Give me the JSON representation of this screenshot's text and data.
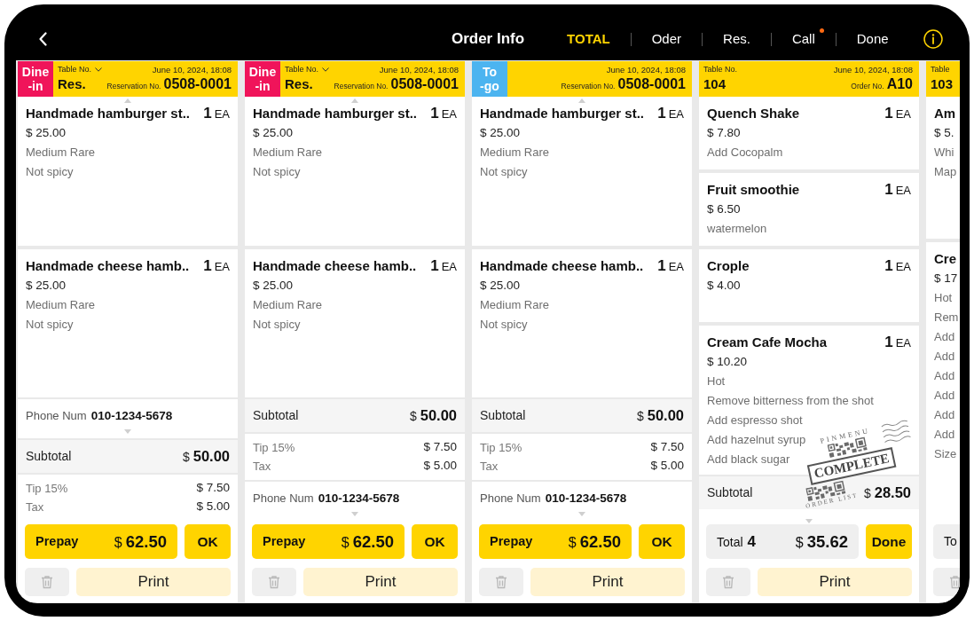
{
  "header": {
    "title": "Order Info",
    "tabs": [
      {
        "label": "TOTAL",
        "selected": true,
        "badge": false
      },
      {
        "label": "Oder",
        "selected": false,
        "badge": false
      },
      {
        "label": "Res.",
        "selected": false,
        "badge": false
      },
      {
        "label": "Call",
        "selected": false,
        "badge": true
      },
      {
        "label": "Done",
        "selected": false,
        "badge": false
      }
    ]
  },
  "orders": [
    {
      "type": {
        "kind": "dine_in",
        "label": "Dine\n-in"
      },
      "table": {
        "label": "Table No.",
        "dropdown": true,
        "value": "Res."
      },
      "date": "June 10, 2024, 18:08",
      "number": {
        "label": "Reservation No.",
        "value": "0508-0001"
      },
      "more_above": true,
      "items": [
        {
          "name": "Handmade hamburger st..",
          "qty": "1",
          "unit": "EA",
          "price": "$ 25.00",
          "options": [
            "Medium Rare",
            "Not spicy"
          ]
        },
        {
          "name": "Handmade cheese hamb..",
          "qty": "1",
          "unit": "EA",
          "price": "$ 25.00",
          "options": [
            "Medium Rare",
            "Not spicy"
          ]
        }
      ],
      "summary": [
        {
          "kind": "phone",
          "label": "Phone Num",
          "value": "010-1234-5678"
        },
        {
          "kind": "subtotal",
          "label": "Subtotal",
          "currency": "$",
          "value": "50.00"
        },
        {
          "kind": "charges",
          "lines": [
            {
              "label": "Tip 15%",
              "value": "$ 7.50"
            },
            {
              "label": "Tax",
              "value": "$ 5.00"
            }
          ]
        }
      ],
      "pay": {
        "kind": "prepay",
        "label": "Prepay",
        "currency": "$",
        "amount": "62.50"
      },
      "action": "OK",
      "print": "Print"
    },
    {
      "type": {
        "kind": "dine_in",
        "label": "Dine\n-in"
      },
      "table": {
        "label": "Table No.",
        "dropdown": true,
        "value": "Res."
      },
      "date": "June 10, 2024, 18:08",
      "number": {
        "label": "Reservation No.",
        "value": "0508-0001"
      },
      "more_above": true,
      "items": [
        {
          "name": "Handmade hamburger st..",
          "qty": "1",
          "unit": "EA",
          "price": "$ 25.00",
          "options": [
            "Medium Rare",
            "Not spicy"
          ]
        },
        {
          "name": "Handmade cheese hamb..",
          "qty": "1",
          "unit": "EA",
          "price": "$ 25.00",
          "options": [
            "Medium Rare",
            "Not spicy"
          ]
        }
      ],
      "summary": [
        {
          "kind": "subtotal",
          "label": "Subtotal",
          "currency": "$",
          "value": "50.00"
        },
        {
          "kind": "charges",
          "lines": [
            {
              "label": "Tip 15%",
              "value": "$ 7.50"
            },
            {
              "label": "Tax",
              "value": "$ 5.00"
            }
          ]
        },
        {
          "kind": "phone",
          "label": "Phone Num",
          "value": "010-1234-5678"
        }
      ],
      "pay": {
        "kind": "prepay",
        "label": "Prepay",
        "currency": "$",
        "amount": "62.50"
      },
      "action": "OK",
      "print": "Print"
    },
    {
      "type": {
        "kind": "to_go",
        "label": "To\n-go"
      },
      "date": "June 10, 2024, 18:08",
      "number": {
        "label": "Reservation No.",
        "value": "0508-0001"
      },
      "more_above": true,
      "items": [
        {
          "name": "Handmade hamburger st..",
          "qty": "1",
          "unit": "EA",
          "price": "$ 25.00",
          "options": [
            "Medium Rare",
            "Not spicy"
          ]
        },
        {
          "name": "Handmade cheese hamb..",
          "qty": "1",
          "unit": "EA",
          "price": "$ 25.00",
          "options": [
            "Medium Rare",
            "Not spicy"
          ]
        }
      ],
      "summary": [
        {
          "kind": "subtotal",
          "label": "Subtotal",
          "currency": "$",
          "value": "50.00"
        },
        {
          "kind": "charges",
          "lines": [
            {
              "label": "Tip 15%",
              "value": "$ 7.50"
            },
            {
              "label": "Tax",
              "value": "$ 5.00"
            }
          ]
        },
        {
          "kind": "phone",
          "label": "Phone Num",
          "value": "010-1234-5678"
        }
      ],
      "pay": {
        "kind": "prepay",
        "label": "Prepay",
        "currency": "$",
        "amount": "62.50"
      },
      "action": "OK",
      "print": "Print"
    },
    {
      "table": {
        "label": "Table No.",
        "dropdown": false,
        "value": "104"
      },
      "date": "June 10, 2024, 18:08",
      "number": {
        "label": "Order No.",
        "value": "A10"
      },
      "more_above": false,
      "items": [
        {
          "name": "Quench Shake",
          "qty": "1",
          "unit": "EA",
          "price": "$ 7.80",
          "options": [
            "Add Cocopalm"
          ]
        },
        {
          "name": "Fruit smoothie",
          "qty": "1",
          "unit": "EA",
          "price": "$ 6.50",
          "options": [
            "watermelon"
          ]
        },
        {
          "name": "Crople",
          "qty": "1",
          "unit": "EA",
          "price": "$ 4.00"
        },
        {
          "name": "Cream Cafe Mocha",
          "qty": "1",
          "unit": "EA",
          "price": "$ 10.20",
          "options": [
            "Hot",
            "Remove bitterness from the shot",
            "Add espresso shot",
            "Add hazelnut syrup",
            "Add black sugar"
          ]
        }
      ],
      "summary": [
        {
          "kind": "subtotal",
          "label": "Subtotal",
          "currency": "$",
          "value": "28.50"
        }
      ],
      "pay": {
        "kind": "total",
        "label": "Total",
        "count": "4",
        "currency": "$",
        "amount": "35.62"
      },
      "action": "Done",
      "print": "Print",
      "stamp": {
        "brand": "PINMENU",
        "status": "COMPLETE",
        "caption": "ORDER LIST"
      }
    },
    {
      "table": {
        "label": "Table",
        "dropdown": false,
        "value": "103"
      },
      "more_above": false,
      "items": [
        {
          "name": "Am",
          "price": "$ 5.",
          "options": [
            "Whi",
            "Map"
          ]
        },
        {
          "name": "Cre",
          "price": "$ 17",
          "options": [
            "Hot",
            "Rem",
            "Add",
            "Add",
            "Add",
            "Add",
            "Add",
            "Add",
            "Size"
          ]
        }
      ],
      "pay": {
        "kind": "total",
        "label": "To"
      }
    }
  ]
}
